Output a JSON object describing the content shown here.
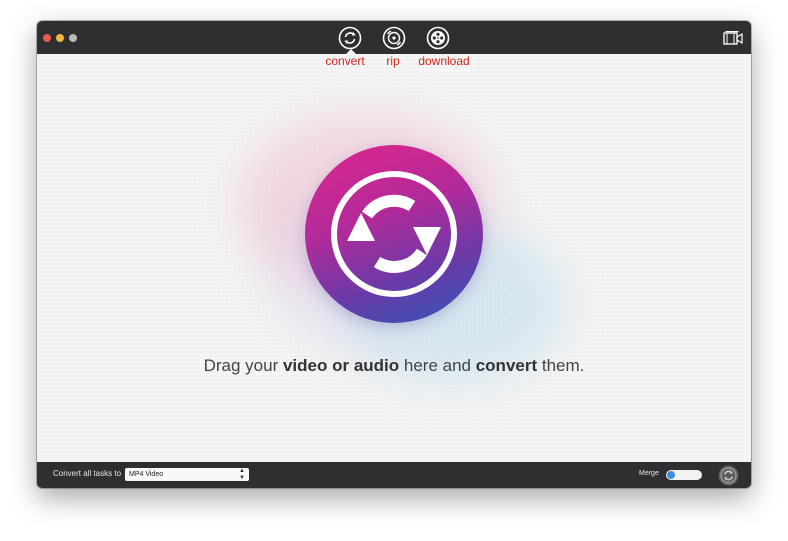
{
  "window": {
    "controls": [
      "close",
      "minimize",
      "zoom"
    ]
  },
  "toolbar": {
    "tabs": [
      {
        "label": "convert",
        "icon": "convert-icon",
        "selected": true
      },
      {
        "label": "rip",
        "icon": "rip-disc-icon",
        "selected": false
      },
      {
        "label": "download",
        "icon": "download-film-icon",
        "selected": false
      }
    ],
    "label_color": "#d0261b",
    "media_browser_icon": "media-browser-icon"
  },
  "main": {
    "drop_icon": "convert-arrows-icon",
    "drop_text": {
      "part1": "Drag your ",
      "bold1": "video or audio",
      "part2": " here and ",
      "bold2": "convert",
      "part3": " them."
    },
    "gradient_colors": [
      "#e0268a",
      "#6a3aa8",
      "#2f58b5"
    ]
  },
  "bottom_bar": {
    "convert_all_label": "Convert all tasks to",
    "format_value": "MP4 Video",
    "merge_label": "Merge",
    "merge_on": false,
    "run_icon": "convert-run-icon"
  }
}
